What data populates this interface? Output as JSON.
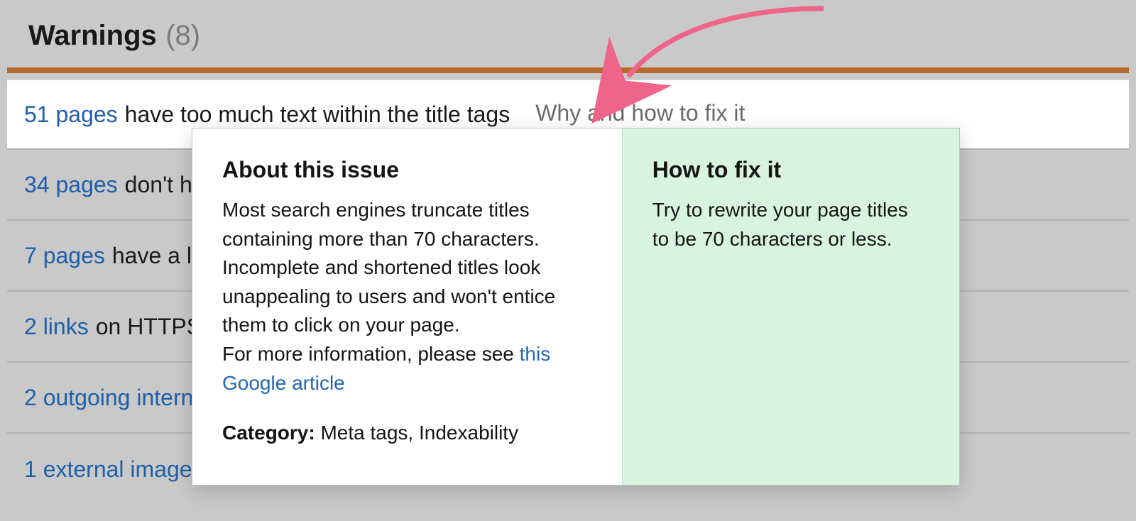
{
  "header": {
    "title": "Warnings",
    "count": "(8)"
  },
  "issues": [
    {
      "count_link": "51 pages",
      "text": "have too much text within the title tags",
      "fix_label": "Why and how to fix it",
      "active": true
    },
    {
      "count_link": "34 pages",
      "text": "don't h",
      "fix_label": "",
      "active": false
    },
    {
      "count_link": "7 pages",
      "text": "have a lo",
      "fix_label": "",
      "active": false
    },
    {
      "count_link": "2 links",
      "text": "on HTTPS",
      "fix_label": "",
      "active": false
    },
    {
      "count_link": "2 outgoing intern",
      "text": "",
      "fix_label": "",
      "active": false
    },
    {
      "count_link": "1 external image",
      "text": "",
      "fix_label": "",
      "active": false
    }
  ],
  "popover": {
    "about": {
      "title": "About this issue",
      "body1": "Most search engines truncate titles containing more than 70 characters. Incomplete and shortened titles look unappealing to users and won't entice them to click on your page.",
      "body2_prefix": "For more information, please see ",
      "body2_link": "this Google article",
      "category_label": "Category:",
      "category_value": "Meta tags, Indexability"
    },
    "fix": {
      "title": "How to fix it",
      "body": "Try to rewrite your page titles to be 70 characters or less."
    }
  },
  "colors": {
    "accent_orange": "#b86a2b",
    "link_blue": "#2066b5",
    "fix_bg": "#d8f4df",
    "arrow": "#ef6489"
  }
}
